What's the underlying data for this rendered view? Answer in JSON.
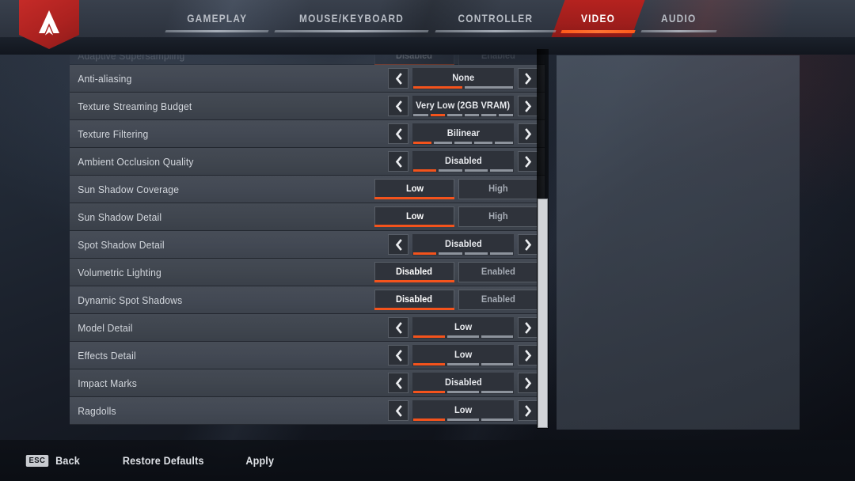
{
  "header": {
    "logo_icon": "apex-legends-logo-icon",
    "tabs": [
      {
        "label": "GAMEPLAY",
        "active": false
      },
      {
        "label": "MOUSE/KEYBOARD",
        "active": false
      },
      {
        "label": "CONTROLLER",
        "active": false
      },
      {
        "label": "VIDEO",
        "active": true
      },
      {
        "label": "AUDIO",
        "active": false
      }
    ]
  },
  "settings": {
    "clipped_top_row": {
      "label": "Adaptive Supersampling",
      "type": "toggle",
      "options": [
        "Disabled",
        "Enabled"
      ],
      "selected_index": 0
    },
    "rows": [
      {
        "label": "Anti-aliasing",
        "type": "stepper",
        "value": "None",
        "segments": 2,
        "selected_index": 0
      },
      {
        "label": "Texture Streaming Budget",
        "type": "stepper",
        "value": "Very Low (2GB VRAM)",
        "segments": 6,
        "selected_index": 1
      },
      {
        "label": "Texture Filtering",
        "type": "stepper",
        "value": "Bilinear",
        "segments": 5,
        "selected_index": 0
      },
      {
        "label": "Ambient Occlusion Quality",
        "type": "stepper",
        "value": "Disabled",
        "segments": 4,
        "selected_index": 0
      },
      {
        "label": "Sun Shadow Coverage",
        "type": "toggle",
        "options": [
          "Low",
          "High"
        ],
        "selected_index": 0
      },
      {
        "label": "Sun Shadow Detail",
        "type": "toggle",
        "options": [
          "Low",
          "High"
        ],
        "selected_index": 0
      },
      {
        "label": "Spot Shadow Detail",
        "type": "stepper",
        "value": "Disabled",
        "segments": 4,
        "selected_index": 0
      },
      {
        "label": "Volumetric Lighting",
        "type": "toggle",
        "options": [
          "Disabled",
          "Enabled"
        ],
        "selected_index": 0
      },
      {
        "label": "Dynamic Spot Shadows",
        "type": "toggle",
        "options": [
          "Disabled",
          "Enabled"
        ],
        "selected_index": 0
      },
      {
        "label": "Model Detail",
        "type": "stepper",
        "value": "Low",
        "segments": 3,
        "selected_index": 0
      },
      {
        "label": "Effects Detail",
        "type": "stepper",
        "value": "Low",
        "segments": 3,
        "selected_index": 0
      },
      {
        "label": "Impact Marks",
        "type": "stepper",
        "value": "Disabled",
        "segments": 3,
        "selected_index": 0
      },
      {
        "label": "Ragdolls",
        "type": "stepper",
        "value": "Low",
        "segments": 3,
        "selected_index": 0
      }
    ]
  },
  "footer": {
    "back": {
      "key": "ESC",
      "label": "Back"
    },
    "restore_defaults_label": "Restore Defaults",
    "apply_label": "Apply"
  },
  "colors": {
    "accent_orange": "#f4531c",
    "tab_active_red": "#a01e1c",
    "row_background": "#434954",
    "text_primary": "#e8eaee",
    "text_secondary": "#a5abb4"
  }
}
